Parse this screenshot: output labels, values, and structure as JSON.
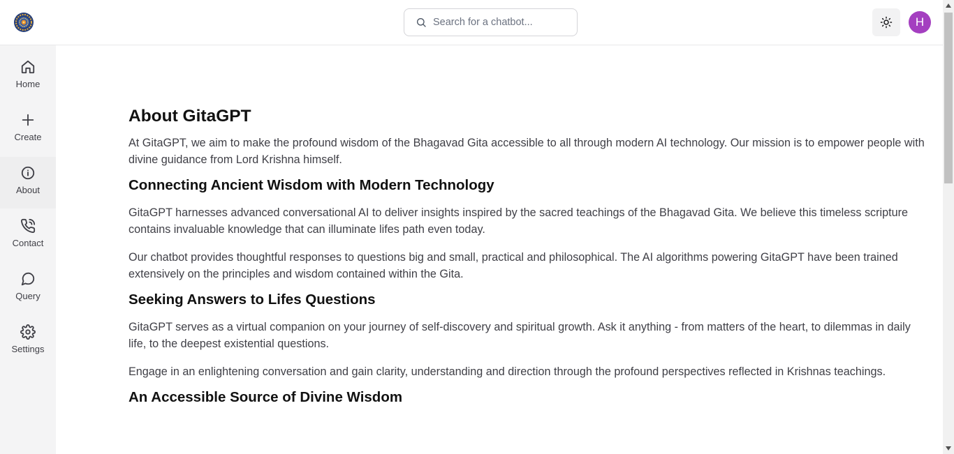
{
  "header": {
    "logo": "gitagpt-logo",
    "search_placeholder": "Search for a chatbot...",
    "theme_icon": "sun-icon",
    "avatar_initial": "H",
    "avatar_color": "#a43fc0"
  },
  "sidebar": {
    "items": [
      {
        "label": "Home",
        "icon": "home-icon"
      },
      {
        "label": "Create",
        "icon": "plus-icon"
      },
      {
        "label": "About",
        "icon": "info-icon",
        "active": true
      },
      {
        "label": "Contact",
        "icon": "phone-icon"
      },
      {
        "label": "Query",
        "icon": "message-circle-icon"
      },
      {
        "label": "Settings",
        "icon": "gear-icon"
      }
    ]
  },
  "page": {
    "title": "About GitaGPT",
    "intro": "At GitaGPT, we aim to make the profound wisdom of the Bhagavad Gita accessible to all through modern AI technology. Our mission is to empower people with divine guidance from Lord Krishna himself.",
    "sections": [
      {
        "heading": "Connecting Ancient Wisdom with Modern Technology",
        "paragraphs": [
          "GitaGPT harnesses advanced conversational AI to deliver insights inspired by the sacred teachings of the Bhagavad Gita. We believe this timeless scripture contains invaluable knowledge that can illuminate lifes path even today.",
          "Our chatbot provides thoughtful responses to questions big and small, practical and philosophical. The AI algorithms powering GitaGPT have been trained extensively on the principles and wisdom contained within the Gita."
        ]
      },
      {
        "heading": "Seeking Answers to Lifes Questions",
        "paragraphs": [
          "GitaGPT serves as a virtual companion on your journey of self-discovery and spiritual growth. Ask it anything - from matters of the heart, to dilemmas in daily life, to the deepest existential questions.",
          "Engage in an enlightening conversation and gain clarity, understanding and direction through the profound perspectives reflected in Krishnas teachings."
        ]
      },
      {
        "heading": "An Accessible Source of Divine Wisdom",
        "paragraphs": []
      }
    ]
  }
}
